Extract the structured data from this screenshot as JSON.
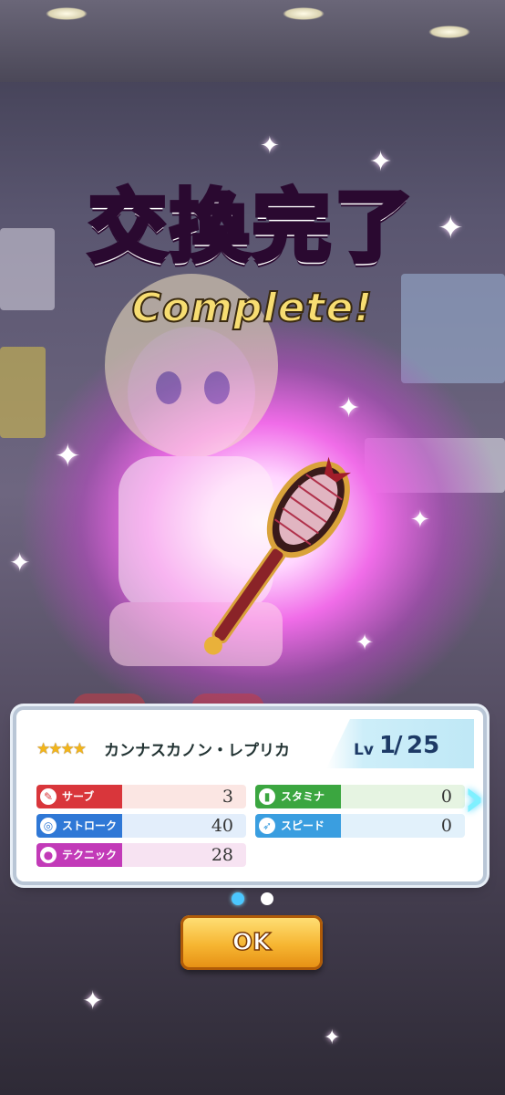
{
  "title": "交換完了",
  "subtitle": "Complete!",
  "item": {
    "rarity_stars": "★★★★",
    "name": "カンナスカノン・レプリカ",
    "level_label": "Lv",
    "level_current": "1",
    "level_separator": "/",
    "level_max": "25"
  },
  "stats": [
    {
      "label": "サーブ",
      "value": "3",
      "icon": "serve-icon",
      "color": "#d9363b"
    },
    {
      "label": "ストローク",
      "value": "40",
      "icon": "stroke-icon",
      "color": "#2f78d6"
    },
    {
      "label": "テクニック",
      "value": "28",
      "icon": "technique-icon",
      "color": "#c23ab8"
    },
    {
      "label": "スタミナ",
      "value": "0",
      "icon": "stamina-icon",
      "color": "#3ba640"
    },
    {
      "label": "スピード",
      "value": "0",
      "icon": "speed-icon",
      "color": "#3a9ee0"
    }
  ],
  "pagination": {
    "current": 1,
    "total": 2
  },
  "ok_label": "OK"
}
